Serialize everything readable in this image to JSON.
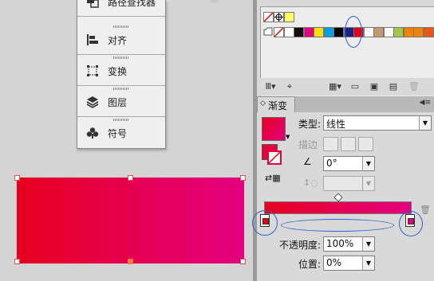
{
  "colors": {
    "gradient_start": "#e6001e",
    "gradient_end": "#e4007f",
    "annotation": "#2f62c8",
    "canvas_bg": "#d4d4d4",
    "panel_bg": "#d9d9d9"
  },
  "floating_panel": {
    "items": [
      {
        "label": "路径查找器",
        "icon": "pathfinder-icon"
      },
      {
        "label": "对齐",
        "icon": "align-icon"
      },
      {
        "label": "变换",
        "icon": "transform-icon"
      },
      {
        "label": "图层",
        "icon": "layers-icon"
      },
      {
        "label": "符号",
        "icon": "symbols-icon"
      }
    ]
  },
  "swatches": {
    "row1": [
      "none",
      "registration",
      "#ffff66"
    ],
    "row2": [
      "none",
      "#ffffff",
      "#111111",
      "#e4007f",
      "#ffe100",
      "#00a0e9",
      "#000000",
      "#1d2088",
      "#e60012",
      "#ffffff",
      "#c49a6c",
      "#ffffff",
      "#a0c846",
      "#f08300",
      "#f08300",
      "#ea5514"
    ]
  },
  "swatch_toolbar": {
    "icons": [
      "swatch-library-icon",
      "show-kinds-icon",
      "swatch-options-icon",
      "color-group-icon",
      "new-color-group-icon",
      "new-swatch-icon",
      "delete-swatch-icon"
    ]
  },
  "gradient_panel": {
    "tab_label": "渐变",
    "type_label": "类型:",
    "type_value": "线性",
    "stroke_label": "描边",
    "angle_value": "0°",
    "aspect_value": "",
    "opacity_label": "不透明度:",
    "opacity_value": "100%",
    "location_label": "位置:",
    "location_value": "0%"
  }
}
